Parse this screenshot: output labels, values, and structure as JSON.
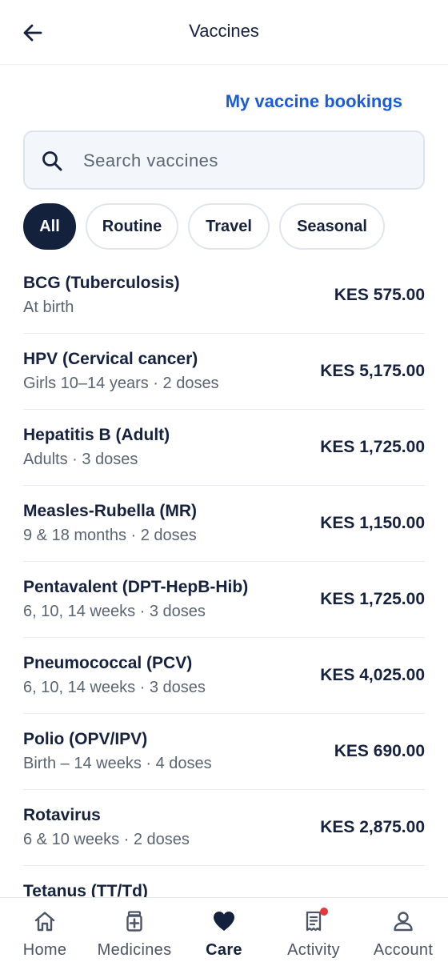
{
  "header": {
    "title": "Vaccines"
  },
  "bookings_link": "My vaccine bookings",
  "search": {
    "placeholder": "Search vaccines",
    "value": ""
  },
  "filters": {
    "all": "All",
    "routine": "Routine",
    "travel": "Travel",
    "seasonal": "Seasonal",
    "selected": "All"
  },
  "vaccines": [
    {
      "name": "BCG (Tuberculosis)",
      "detail": "At birth",
      "price": "KES 575.00"
    },
    {
      "name": "HPV (Cervical cancer)",
      "detail": "Girls 10–14 years · 2 doses",
      "price": "KES 5,175.00"
    },
    {
      "name": "Hepatitis B (Adult)",
      "detail": "Adults · 3 doses",
      "price": "KES 1,725.00"
    },
    {
      "name": "Measles-Rubella (MR)",
      "detail": "9 & 18 months · 2 doses",
      "price": "KES 1,150.00"
    },
    {
      "name": "Pentavalent (DPT-HepB-Hib)",
      "detail": "6, 10, 14 weeks · 3 doses",
      "price": "KES 1,725.00"
    },
    {
      "name": "Pneumococcal (PCV)",
      "detail": "6, 10, 14 weeks · 3 doses",
      "price": "KES 4,025.00"
    },
    {
      "name": "Polio (OPV/IPV)",
      "detail": "Birth – 14 weeks · 4 doses",
      "price": "KES 690.00"
    },
    {
      "name": "Rotavirus",
      "detail": "6 & 10 weeks · 2 doses",
      "price": "KES 2,875.00"
    },
    {
      "name": "Tetanus (TT/Td)"
    }
  ],
  "tabs": {
    "home": "Home",
    "medicines": "Medicines",
    "care": "Care",
    "activity": "Activity",
    "account": "Account",
    "active": "Care"
  },
  "colors": {
    "accent": "#1a5bd6",
    "navy": "#14213d",
    "notification": "#e5383b"
  }
}
